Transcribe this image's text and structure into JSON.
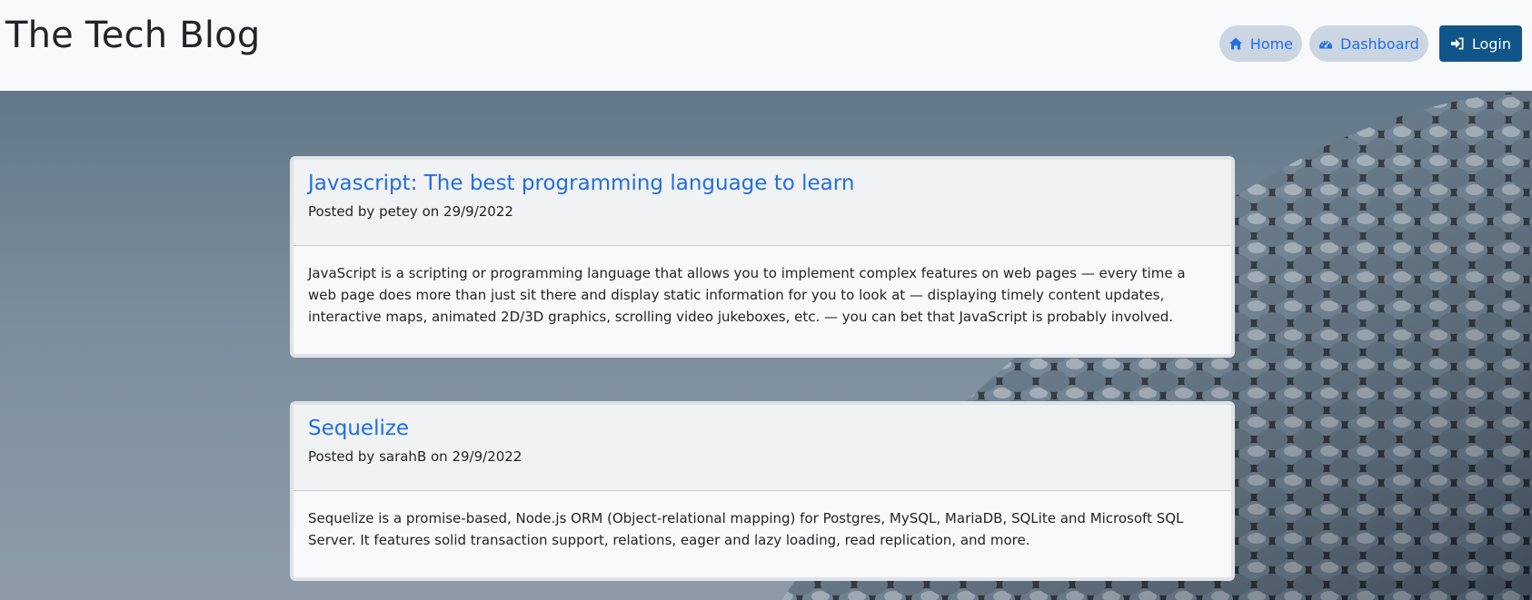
{
  "header": {
    "title": "The Tech Blog",
    "nav": {
      "home_label": "Home",
      "dashboard_label": "Dashboard",
      "login_label": "Login"
    }
  },
  "posts": [
    {
      "title": "Javascript: The best programming language to learn",
      "meta": "Posted by petey on 29/9/2022",
      "body": "JavaScript is a scripting or programming language that allows you to implement complex features on web pages — every time a web page does more than just sit there and display static information for you to look at — displaying timely content updates, interactive maps, animated 2D/3D graphics, scrolling video jukeboxes, etc. — you can bet that JavaScript is probably involved."
    },
    {
      "title": "Sequelize",
      "meta": "Posted by sarahB on 29/9/2022",
      "body": "Sequelize is a promise-based, Node.js ORM (Object-relational mapping) for Postgres, MySQL, MariaDB, SQLite and Microsoft SQL Server. It features solid transaction support, relations, eager and lazy loading, read replication, and more."
    }
  ],
  "colors": {
    "link": "#1f6fe5",
    "login_bg": "#0f558a",
    "nav_pill_bg": "#ccd6e2"
  },
  "icons": {
    "home": "home-icon",
    "dashboard": "dashboard-icon",
    "login": "sign-in-icon"
  }
}
